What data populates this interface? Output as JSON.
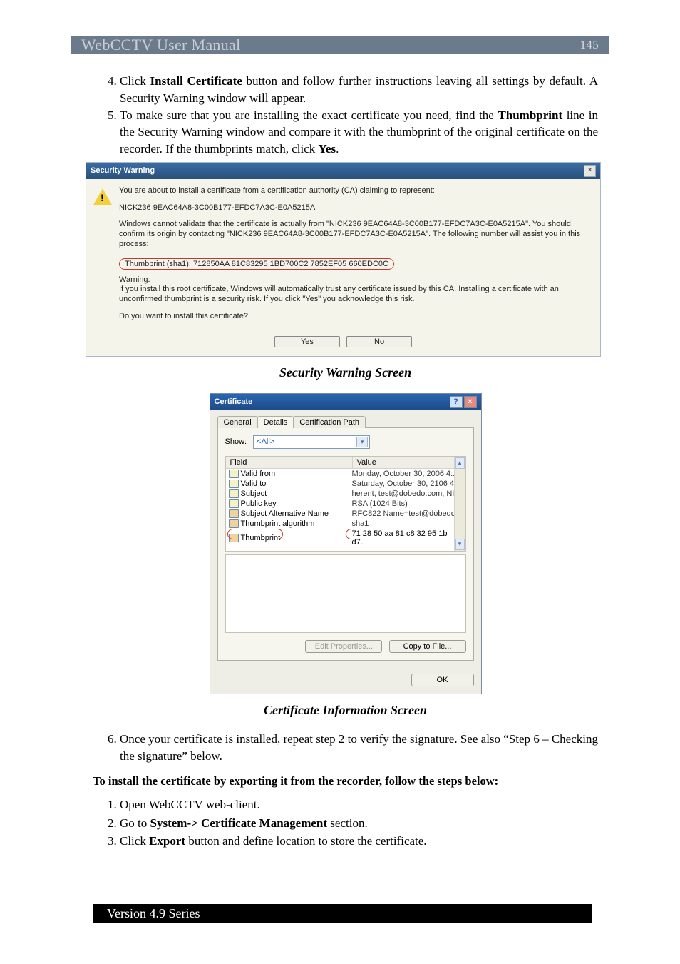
{
  "header": {
    "title": "WebCCTV User Manual",
    "pageno": "145"
  },
  "steps_top": [
    {
      "num": "4.",
      "parts": [
        "Click ",
        {
          "b": "Install Certificate"
        },
        " button and follow further instructions leaving all settings by default. A Security Warning window will appear."
      ]
    },
    {
      "num": "5.",
      "parts": [
        "To make sure that you are installing the exact certificate you need, find the ",
        {
          "b": "Thumbprint"
        },
        " line in the Security Warning window and compare it with the thumbprint of the original certificate on the recorder. If the thumbprints match, click ",
        {
          "b": "Yes"
        },
        "."
      ]
    }
  ],
  "secwarn": {
    "title": "Security Warning",
    "close_icon": "×",
    "p1": "You are about to install a certificate from a certification authority (CA) claiming to represent:",
    "p2": "NICK236 9EAC64A8-3C00B177-EFDC7A3C-E0A5215A",
    "p3": "Windows cannot validate that the certificate is actually from \"NICK236 9EAC64A8-3C00B177-EFDC7A3C-E0A5215A\". You should confirm its origin by contacting \"NICK236 9EAC64A8-3C00B177-EFDC7A3C-E0A5215A\". The following number will assist you in this process:",
    "thumb": "Thumbprint (sha1): 712850AA 81C83295 1BD700C2 7852EF05 660EDC0C",
    "p4a": "Warning:",
    "p4b": "If you install this root certificate, Windows will automatically trust any certificate issued by this CA. Installing a certificate with an unconfirmed thumbprint is a security risk. If you click \"Yes\" you acknowledge this risk.",
    "p5": "Do you want to install this certificate?",
    "yes": "Yes",
    "no": "No"
  },
  "caption1": "Security Warning Screen",
  "cert": {
    "title": "Certificate",
    "tabs": {
      "general": "General",
      "details": "Details",
      "path": "Certification Path"
    },
    "show_label": "Show:",
    "show_value": "<All>",
    "col_field": "Field",
    "col_value": "Value",
    "rows": [
      {
        "f": "Valid from",
        "v": "Monday, October 30, 2006 4:...",
        "alt": false
      },
      {
        "f": "Valid to",
        "v": "Saturday, October 30, 2106 4...",
        "alt": false
      },
      {
        "f": "Subject",
        "v": "herent, test@dobedo.com, NI...",
        "alt": false
      },
      {
        "f": "Public key",
        "v": "RSA (1024 Bits)",
        "alt": false
      },
      {
        "f": "Subject Alternative Name",
        "v": "RFC822 Name=test@dobedo...",
        "alt": true
      },
      {
        "f": "Thumbprint algorithm",
        "v": "sha1",
        "alt": true
      },
      {
        "f": "Thumbprint",
        "v": "71 28 50 aa 81 c8 32 95 1b d7...",
        "alt": true
      }
    ],
    "btn_edit": "Edit Properties...",
    "btn_copy": "Copy to File...",
    "btn_ok": "OK"
  },
  "caption2": "Certificate Information Screen",
  "step6": {
    "parts": [
      "Once your certificate is installed, repeat step 2 to verify the signature. See also “Step 6 – Checking the signature” below."
    ]
  },
  "instr_head": "To install the certificate by exporting it from the recorder, follow the steps below:",
  "steps_bottom": [
    {
      "parts": [
        "Open WebCCTV web-client."
      ]
    },
    {
      "parts": [
        "Go to ",
        {
          "b": "System-> Certificate Management"
        },
        " section."
      ]
    },
    {
      "parts": [
        "Click ",
        {
          "b": "Export"
        },
        " button and define location to store the certificate."
      ]
    }
  ],
  "footer": "Version 4.9 Series"
}
